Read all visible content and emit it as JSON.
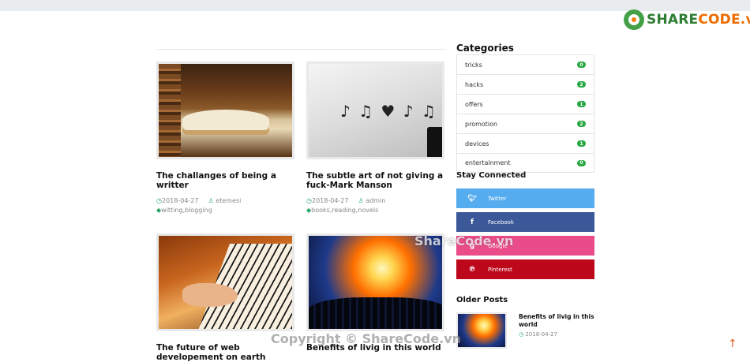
{
  "logo": {
    "text_a": "SHARE",
    "text_b": "CODE.vn"
  },
  "posts": [
    {
      "title": "The challanges of being a writter",
      "date": "2018-04-27",
      "author": "etemesi",
      "tags": "witting,blogging"
    },
    {
      "title": "The subtle art of not giving a fuck-Mark Manson",
      "date": "2018-04-27",
      "author": "admin",
      "tags": "books,reading,novels"
    },
    {
      "title": "The future of web developement on earth"
    },
    {
      "title": "Benefits of livig in this world"
    }
  ],
  "sidebar": {
    "categories_heading": "Categories",
    "categories": [
      {
        "name": "tricks",
        "count": "0"
      },
      {
        "name": "hacks",
        "count": "2"
      },
      {
        "name": "offers",
        "count": "1"
      },
      {
        "name": "promotion",
        "count": "2"
      },
      {
        "name": "devices",
        "count": "1"
      },
      {
        "name": "entertainment",
        "count": "0"
      }
    ],
    "stay_heading": "Stay Connected",
    "social": [
      {
        "label": "Twitter",
        "icon": "twitter-icon"
      },
      {
        "label": "Facebook",
        "icon": "facebook-icon"
      },
      {
        "label": "Google",
        "icon": "google-icon"
      },
      {
        "label": "Pinterest",
        "icon": "pinterest-icon"
      }
    ],
    "older_heading": "Older Posts",
    "older": [
      {
        "title": "Benefits of livig in this world",
        "date": "2018-04-27"
      }
    ]
  },
  "watermark": "ShareCode.vn",
  "copyright": "Copyright © ShareCode.vn",
  "colors": {
    "accent": "#2aa36b",
    "badge": "#27a844",
    "twitter": "#55acee",
    "facebook": "#3b5998",
    "google": "#ea4c89",
    "pinterest": "#bd081c"
  }
}
